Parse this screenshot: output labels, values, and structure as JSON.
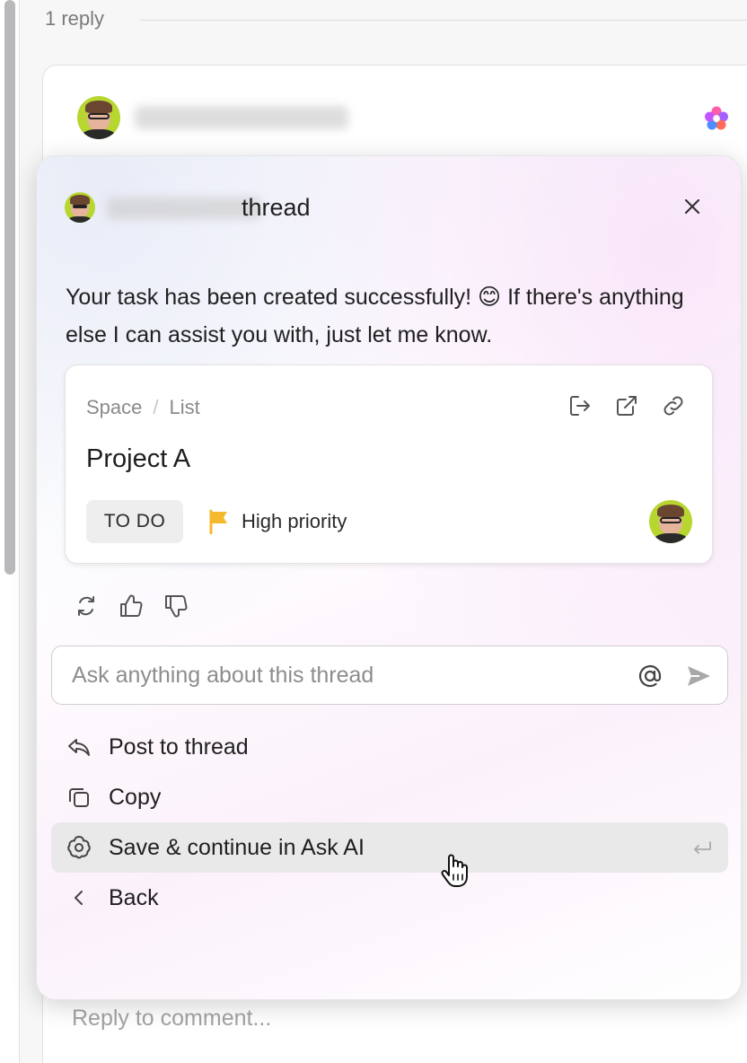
{
  "thread_meta": {
    "reply_count": "1 reply"
  },
  "comment": {
    "reply_placeholder": "Reply to comment..."
  },
  "modal": {
    "title_suffix": "thread",
    "message": "Your task has been created successfully! 😊 If there's anything else I can assist you with, just let me know.",
    "task_card": {
      "breadcrumb_space": "Space",
      "breadcrumb_sep": "/",
      "breadcrumb_list": "List",
      "title": "Project A",
      "status": "TO DO",
      "priority": "High priority",
      "priority_flag_color": "#f5b92e"
    },
    "ask_input": {
      "placeholder": "Ask anything about this thread",
      "value": ""
    },
    "menu": [
      {
        "label": "Post to thread",
        "icon": "reply-icon"
      },
      {
        "label": "Copy",
        "icon": "copy-icon"
      },
      {
        "label": "Save & continue in Ask AI",
        "icon": "ai-brain-icon",
        "active": true
      },
      {
        "label": "Back",
        "icon": "chevron-left-icon"
      }
    ]
  },
  "colors": {
    "avatar_bg": "#b7d62f",
    "active_menu_bg": "#e9e9ea"
  }
}
